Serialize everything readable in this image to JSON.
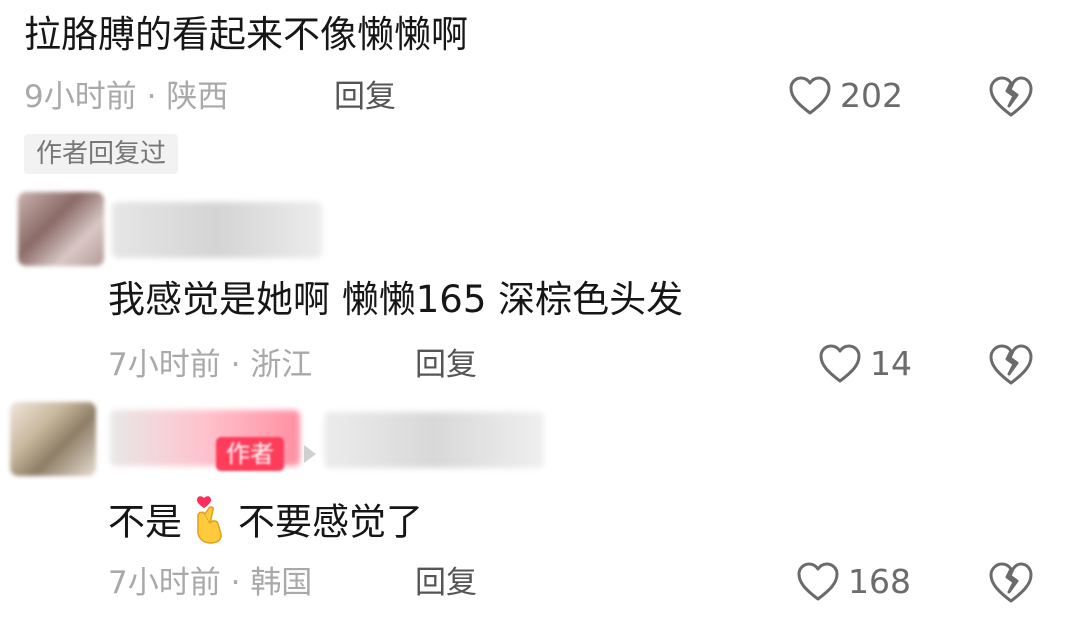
{
  "comments": [
    {
      "text": "拉胳膊的看起来不像懒懒啊",
      "time": "9小时前",
      "location": "陕西",
      "reply_label": "回复",
      "likes": "202",
      "author_replied_label": "作者回复过"
    },
    {
      "text": "我感觉是她啊 懒懒165 深棕色头发",
      "time": "7小时前",
      "location": "浙江",
      "reply_label": "回复",
      "likes": "14"
    },
    {
      "text_before": "不是",
      "text_after": "不要感觉了",
      "emoji": "finger-heart-emoji",
      "author_tag": "作者",
      "time": "7小时前",
      "location": "韩国",
      "reply_label": "回复",
      "likes": "168"
    }
  ],
  "separator": "·",
  "icons": {
    "like": "heart-outline-icon",
    "dislike": "broken-heart-icon"
  },
  "colors": {
    "text": "#161616",
    "meta": "#a9a9a9",
    "reply": "#555555",
    "icon": "#6b6b6b",
    "author_tag_bg": "#ff3d5a",
    "author_replied_bg": "#f2f2f2"
  }
}
